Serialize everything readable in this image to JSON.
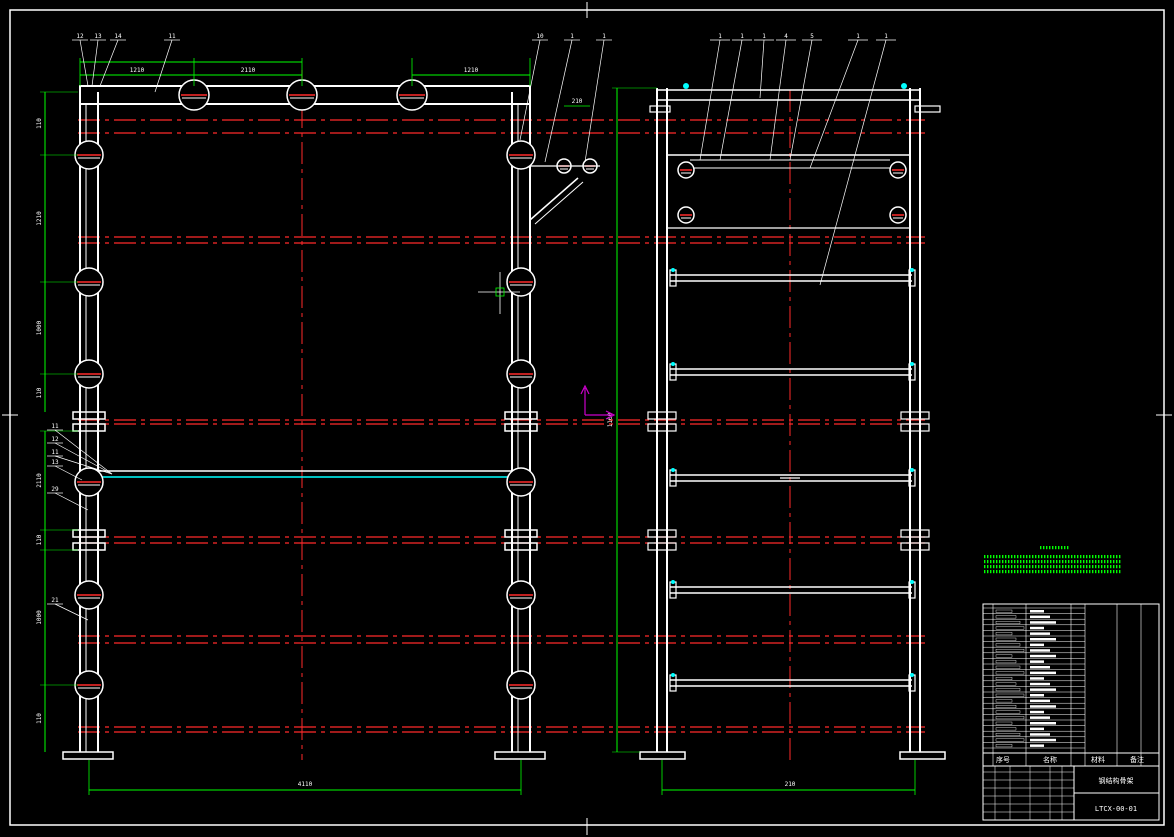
{
  "drawing": {
    "background": "#000000",
    "colors": {
      "outline": "#ffffff",
      "centerline": "#ff2a2a",
      "dimension": "#00ff00",
      "accent": "#00ffff",
      "ucs": "#cc00cc"
    },
    "front_view": {
      "dimensions": {
        "top": [
          "1210",
          "2110",
          "1210"
        ],
        "left": [
          "110",
          "1210",
          "1000",
          "110",
          "2110",
          "110",
          "1000",
          "110"
        ],
        "bottom": "4110"
      },
      "leaders": [
        "12",
        "13",
        "14",
        "11",
        "10",
        "1",
        "1",
        "11",
        "12",
        "11",
        "13",
        "29",
        "21"
      ]
    },
    "side_view": {
      "dimensions": {
        "vertical": "1100",
        "bottom": "210"
      },
      "leaders": [
        "1",
        "1",
        "1",
        "4",
        "5",
        "1",
        "1"
      ]
    },
    "title_block": {
      "drawing_name": "钢结构骨架",
      "drawing_number": "LTCX-00-01",
      "header_labels": [
        "序号",
        "名称",
        "材料",
        "备注"
      ]
    }
  }
}
